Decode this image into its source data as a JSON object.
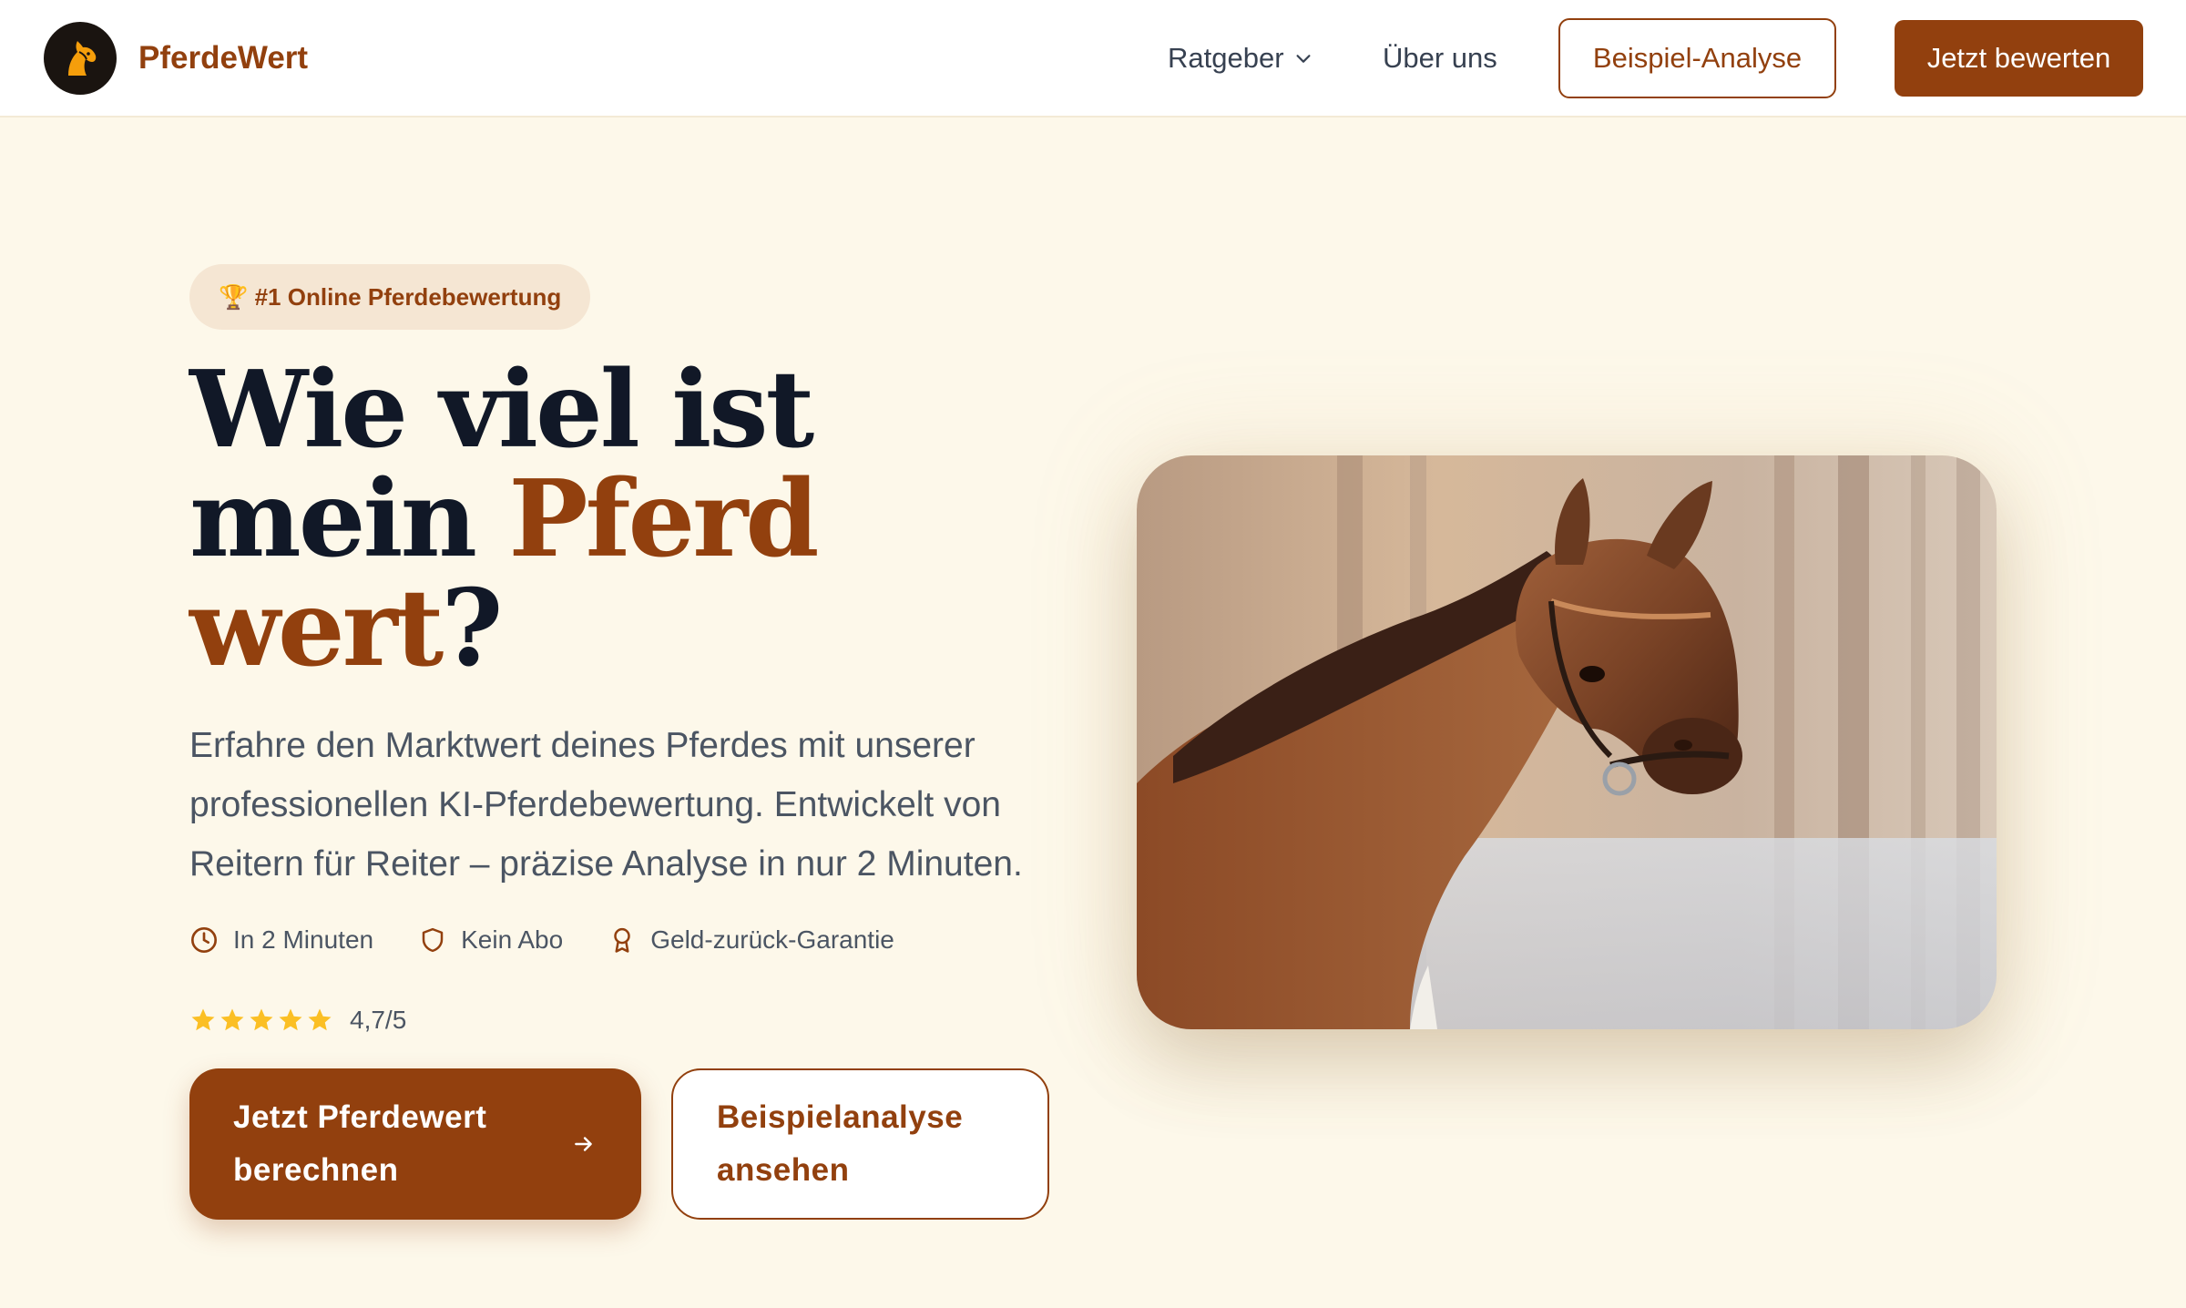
{
  "header": {
    "brand": "PferdeWert",
    "nav": {
      "ratgeber": "Ratgeber",
      "ueber_uns": "Über uns"
    },
    "example_button": "Beispiel-Analyse",
    "cta_button": "Jetzt bewerten"
  },
  "hero": {
    "badge": "🏆 #1 Online Pferdebewertung",
    "headline": {
      "part1": "Wie viel ist mein ",
      "accent": "Pferd wert",
      "part2": "?"
    },
    "subtext": "Erfahre den Marktwert deines Pferdes mit unserer professionellen KI-Pferdebewertung. Entwickelt von Reitern für Reiter – präzise Analyse in nur 2 Minuten.",
    "features": [
      {
        "icon": "clock-icon",
        "label": "In 2 Minuten"
      },
      {
        "icon": "shield-icon",
        "label": "Kein Abo"
      },
      {
        "icon": "award-icon",
        "label": "Geld-zurück-Garantie"
      }
    ],
    "rating": {
      "stars": 5,
      "value": "4,7/5"
    },
    "primary_button": "Jetzt Pferdewert berechnen",
    "secondary_button": "Beispielanalyse ansehen",
    "image": "horse-photo"
  },
  "colors": {
    "brand": "#92400e",
    "background": "#fdf8ea",
    "star": "#fbbf24"
  }
}
